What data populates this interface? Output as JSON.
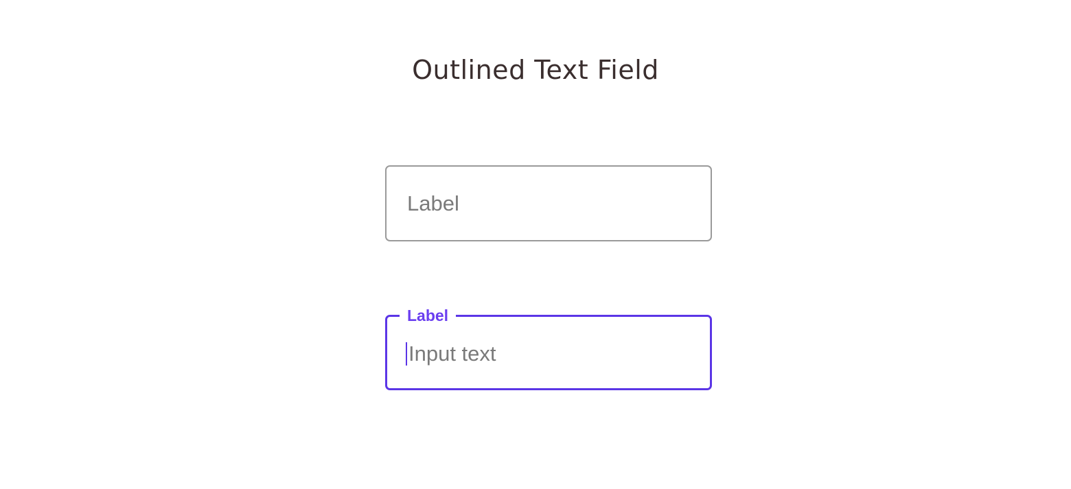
{
  "page": {
    "title": "Outlined Text Field"
  },
  "fields": {
    "default": {
      "label": "Label"
    },
    "focused": {
      "label": "Label",
      "value": "Input text"
    }
  },
  "colors": {
    "outline_default": "#9a9a9a",
    "outline_focused": "#5b35e6",
    "label_focused": "#6a3ef0",
    "text": "#7a7a7a",
    "title": "#3a2e2e"
  }
}
